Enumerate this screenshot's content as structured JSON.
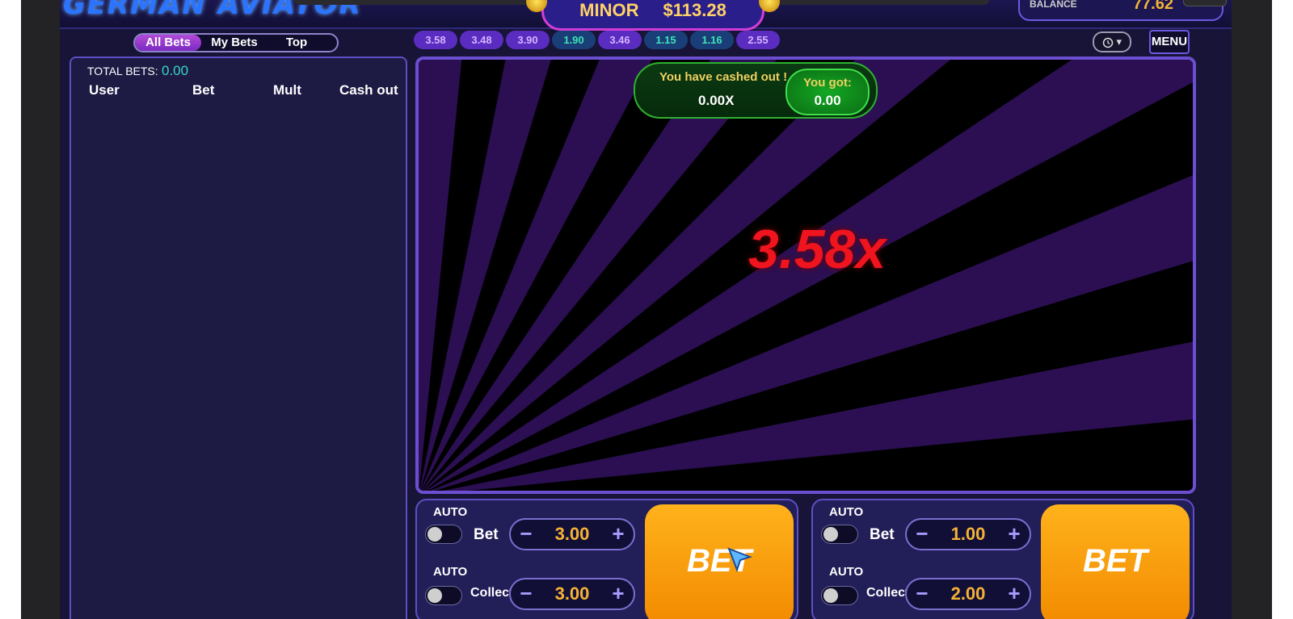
{
  "header": {
    "logo_text": "GERMAN AVIATOR",
    "jackpot_label": "MINOR",
    "jackpot_value": "$113.28",
    "balance_label": "BALANCE",
    "balance_value": "77.62"
  },
  "tabs": [
    {
      "label": "All Bets",
      "active": true
    },
    {
      "label": "My Bets",
      "active": false
    },
    {
      "label": "Top",
      "active": false
    }
  ],
  "history": [
    {
      "value": "3.58",
      "color": "purple"
    },
    {
      "value": "3.48",
      "color": "purple"
    },
    {
      "value": "3.90",
      "color": "purple"
    },
    {
      "value": "1.90",
      "color": "teal"
    },
    {
      "value": "3.46",
      "color": "purple"
    },
    {
      "value": "1.15",
      "color": "teal"
    },
    {
      "value": "1.16",
      "color": "teal"
    },
    {
      "value": "2.55",
      "color": "purple"
    }
  ],
  "history_button_icon": "clock-icon",
  "menu_label": "MENU",
  "bets_panel": {
    "total_label": "TOTAL BETS:",
    "total_value": "0.00",
    "columns": [
      "User",
      "Bet",
      "Mult",
      "Cash out"
    ]
  },
  "game": {
    "multiplier": "3.58x",
    "cashout_title": "You have cashed out !",
    "cashout_mult": "0.00X",
    "you_got_label": "You got:",
    "you_got_value": "0.00"
  },
  "bet_panels": [
    {
      "auto_label": "AUTO",
      "bet_label": "Bet",
      "bet_value": "3.00",
      "collect_auto_label": "AUTO",
      "collect_label": "Collect",
      "collect_value": "3.00",
      "button_label": "BET"
    },
    {
      "auto_label": "AUTO",
      "bet_label": "Bet",
      "bet_value": "1.00",
      "collect_auto_label": "AUTO",
      "collect_label": "Collect",
      "collect_value": "2.00",
      "button_label": "BET"
    }
  ],
  "colors": {
    "background": "#171437",
    "accent_purple": "#6b4fd0",
    "multiplier_red": "#f0141e",
    "bet_orange": "#f5a00c",
    "value_gold": "#f5b335",
    "cashout_green": "#2fb12f"
  }
}
